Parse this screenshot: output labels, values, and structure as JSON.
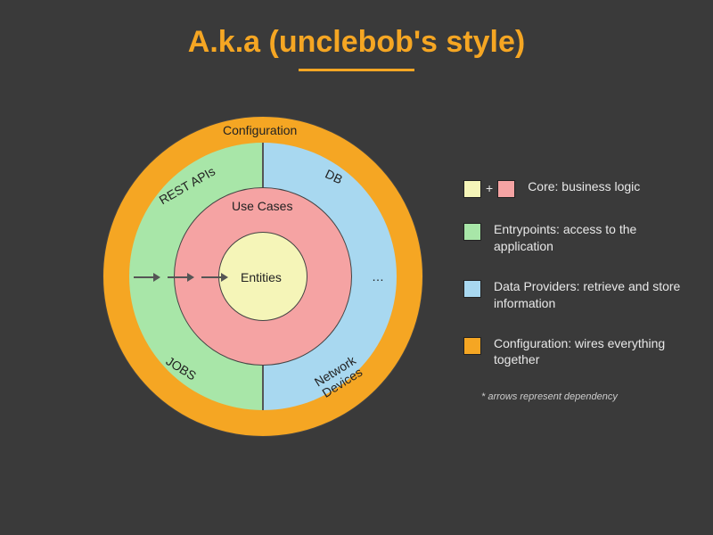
{
  "title": "A.k.a (unclebob's style)",
  "rings": {
    "outer": "Configuration",
    "half_left_top": "REST APIs",
    "half_left_bottom": "JOBS",
    "half_right_top": "DB",
    "half_right_mid": "…",
    "half_right_bottom": "Network Devices",
    "mid": "Use Cases",
    "core": "Entities"
  },
  "colors": {
    "orange": "#f5a623",
    "green": "#a8e6a8",
    "blue": "#a8d8f0",
    "pink": "#f5a3a3",
    "yellow": "#f5f5b8"
  },
  "legend": [
    {
      "kind": "pair",
      "c1": "yellow",
      "c2": "pink",
      "text": "Core: business logic"
    },
    {
      "kind": "single",
      "c": "green",
      "text": "Entrypoints: access to the application"
    },
    {
      "kind": "single",
      "c": "blue",
      "text": "Data Providers: retrieve and store information"
    },
    {
      "kind": "single",
      "c": "orange",
      "text": "Configuration: wires everything together"
    }
  ],
  "footnote": "* arrows represent dependency",
  "arrow_count": 3
}
